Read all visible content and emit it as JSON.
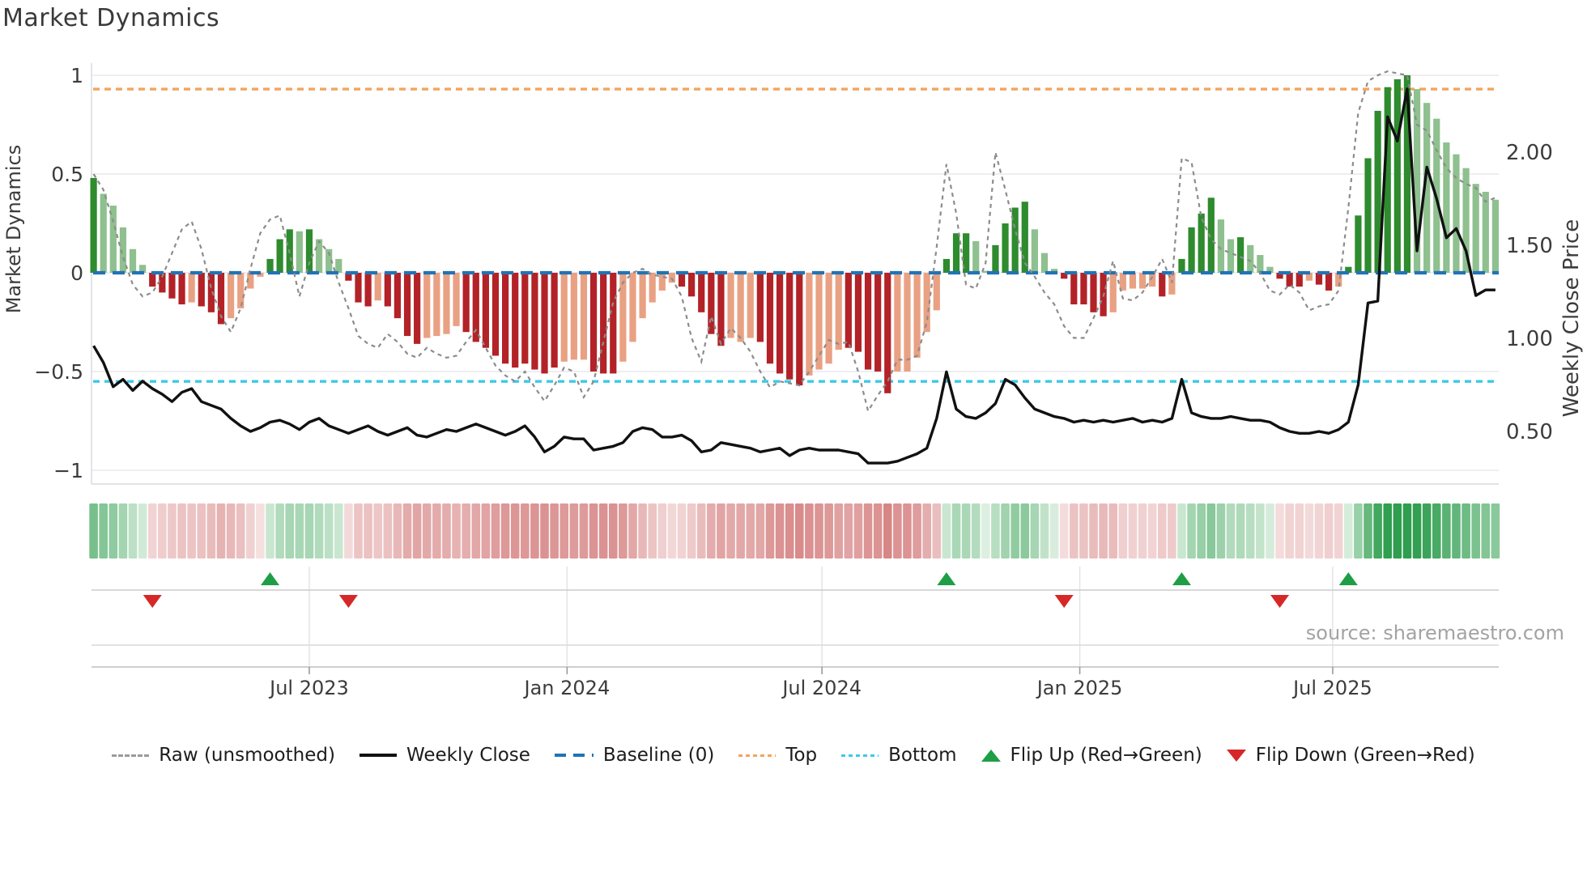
{
  "title": "Market Dynamics",
  "source": "source: sharemaestro.com",
  "axes": {
    "left_label": "Market Dynamics",
    "right_label": "Weekly Close Price",
    "left_ticks": [
      {
        "v": 1,
        "label": "1"
      },
      {
        "v": 0.5,
        "label": "0.5"
      },
      {
        "v": 0,
        "label": "0"
      },
      {
        "v": -0.5,
        "label": "−0.5"
      },
      {
        "v": -1,
        "label": "−1"
      }
    ],
    "right_ticks": [
      {
        "v": 2.0,
        "label": "2.00"
      },
      {
        "v": 1.5,
        "label": "1.50"
      },
      {
        "v": 1.0,
        "label": "1.00"
      },
      {
        "v": 0.5,
        "label": "0.50"
      }
    ],
    "x_ticks": [
      {
        "week": 22,
        "label": "Jul 2023"
      },
      {
        "week": 48.3,
        "label": "Jan 2024"
      },
      {
        "week": 74.3,
        "label": "Jul 2024"
      },
      {
        "week": 100.6,
        "label": "Jan 2025"
      },
      {
        "week": 126.4,
        "label": "Jul 2025"
      }
    ]
  },
  "legend": {
    "items": [
      {
        "label": "Raw (unsmoothed)",
        "swatch": "dashgray"
      },
      {
        "label": "Weekly Close",
        "swatch": "solidblack"
      },
      {
        "label": "Baseline (0)",
        "swatch": "longdashblue"
      },
      {
        "label": "Top",
        "swatch": "dotorange"
      },
      {
        "label": "Bottom",
        "swatch": "dotcyan"
      },
      {
        "label": "Flip Up (Red→Green)",
        "swatch": "triup"
      },
      {
        "label": "Flip Down (Green→Red)",
        "swatch": "tridown"
      }
    ]
  },
  "chart_data": {
    "type": "bar",
    "subtype": "weekly-oscillator-with-price-overlay",
    "x_unit": "week",
    "n_points": 144,
    "ylim_left": [
      -1.07,
      1.06
    ],
    "ylim_right_labels": [
      0.5,
      2.0
    ],
    "grid": "horizontal-left-axis",
    "legend_position": "bottom-center",
    "reference_lines": {
      "baseline": 0,
      "top": 0.93,
      "bottom": -0.55
    },
    "series": [
      {
        "name": "Oscillator (bars)",
        "axis": "left",
        "values": [
          0.48,
          0.4,
          0.34,
          0.23,
          0.12,
          0.04,
          -0.07,
          -0.1,
          -0.13,
          -0.16,
          -0.15,
          -0.17,
          -0.2,
          -0.26,
          -0.23,
          -0.18,
          -0.08,
          -0.02,
          0.07,
          0.17,
          0.22,
          0.21,
          0.22,
          0.17,
          0.12,
          0.07,
          -0.04,
          -0.15,
          -0.17,
          -0.14,
          -0.17,
          -0.23,
          -0.32,
          -0.36,
          -0.33,
          -0.32,
          -0.31,
          -0.27,
          -0.3,
          -0.35,
          -0.38,
          -0.42,
          -0.46,
          -0.48,
          -0.46,
          -0.49,
          -0.51,
          -0.48,
          -0.45,
          -0.44,
          -0.44,
          -0.5,
          -0.51,
          -0.51,
          -0.45,
          -0.35,
          -0.23,
          -0.15,
          -0.09,
          -0.05,
          -0.07,
          -0.12,
          -0.2,
          -0.31,
          -0.37,
          -0.33,
          -0.35,
          -0.33,
          -0.35,
          -0.46,
          -0.51,
          -0.54,
          -0.57,
          -0.52,
          -0.49,
          -0.46,
          -0.39,
          -0.38,
          -0.4,
          -0.49,
          -0.5,
          -0.61,
          -0.5,
          -0.5,
          -0.43,
          -0.3,
          -0.19,
          0.07,
          0.2,
          0.2,
          0.16,
          0.01,
          0.14,
          0.25,
          0.33,
          0.36,
          0.22,
          0.1,
          0.02,
          -0.03,
          -0.16,
          -0.16,
          -0.2,
          -0.22,
          -0.2,
          -0.09,
          -0.08,
          -0.08,
          -0.07,
          -0.12,
          -0.11,
          0.07,
          0.23,
          0.3,
          0.38,
          0.27,
          0.17,
          0.18,
          0.14,
          0.09,
          0.03,
          -0.03,
          -0.07,
          -0.07,
          -0.04,
          -0.06,
          -0.09,
          -0.07,
          0.03,
          0.29,
          0.58,
          0.82,
          0.94,
          0.98,
          1.0,
          0.93,
          0.86,
          0.78,
          0.66,
          0.6,
          0.53,
          0.45,
          0.41,
          0.37
        ],
        "strong_shade": [
          1,
          0,
          0,
          0,
          0,
          0,
          1,
          1,
          1,
          1,
          0,
          1,
          1,
          1,
          0,
          0,
          0,
          0,
          1,
          1,
          1,
          0,
          1,
          0,
          0,
          0,
          1,
          1,
          1,
          0,
          1,
          1,
          1,
          1,
          0,
          0,
          0,
          0,
          1,
          1,
          1,
          1,
          1,
          1,
          1,
          1,
          1,
          1,
          0,
          0,
          0,
          1,
          1,
          1,
          0,
          0,
          0,
          0,
          0,
          0,
          1,
          1,
          1,
          1,
          1,
          0,
          0,
          0,
          1,
          1,
          1,
          1,
          1,
          0,
          0,
          0,
          0,
          1,
          1,
          1,
          1,
          1,
          0,
          0,
          0,
          0,
          0,
          1,
          1,
          1,
          0,
          0,
          1,
          1,
          1,
          1,
          0,
          0,
          0,
          1,
          1,
          1,
          1,
          1,
          0,
          0,
          0,
          0,
          0,
          1,
          0,
          1,
          1,
          1,
          1,
          0,
          0,
          1,
          0,
          0,
          0,
          1,
          1,
          1,
          0,
          1,
          1,
          0,
          1,
          1,
          1,
          1,
          1,
          1,
          1,
          0,
          0,
          0,
          0,
          0,
          0,
          0,
          0,
          0
        ]
      },
      {
        "name": "Raw (unsmoothed)",
        "axis": "left",
        "values": [
          0.5,
          0.42,
          0.26,
          0.08,
          -0.06,
          -0.12,
          -0.1,
          -0.02,
          0.1,
          0.22,
          0.26,
          0.12,
          -0.08,
          -0.22,
          -0.3,
          -0.18,
          0.02,
          0.2,
          0.27,
          0.29,
          0.1,
          -0.12,
          0.05,
          0.16,
          0.1,
          -0.05,
          -0.18,
          -0.32,
          -0.36,
          -0.38,
          -0.31,
          -0.35,
          -0.41,
          -0.43,
          -0.38,
          -0.41,
          -0.43,
          -0.42,
          -0.35,
          -0.29,
          -0.38,
          -0.47,
          -0.52,
          -0.55,
          -0.5,
          -0.58,
          -0.65,
          -0.57,
          -0.48,
          -0.5,
          -0.63,
          -0.55,
          -0.35,
          -0.15,
          -0.05,
          0.0,
          0.02,
          -0.01,
          -0.02,
          -0.03,
          -0.12,
          -0.33,
          -0.45,
          -0.22,
          -0.36,
          -0.28,
          -0.33,
          -0.4,
          -0.5,
          -0.58,
          -0.55,
          -0.56,
          -0.57,
          -0.5,
          -0.42,
          -0.34,
          -0.36,
          -0.35,
          -0.5,
          -0.7,
          -0.62,
          -0.55,
          -0.44,
          -0.44,
          -0.42,
          -0.25,
          0.13,
          0.55,
          0.3,
          -0.06,
          -0.08,
          0.05,
          0.61,
          0.42,
          0.22,
          0.05,
          -0.02,
          -0.1,
          -0.16,
          -0.27,
          -0.33,
          -0.33,
          -0.23,
          -0.12,
          0.06,
          -0.13,
          -0.14,
          -0.1,
          -0.02,
          0.07,
          -0.05,
          0.58,
          0.56,
          0.28,
          0.17,
          0.12,
          0.1,
          0.08,
          0.06,
          0.0,
          -0.09,
          -0.11,
          -0.06,
          -0.1,
          -0.19,
          -0.17,
          -0.16,
          -0.09,
          0.33,
          0.81,
          0.97,
          1.0,
          1.02,
          1.01,
          1.0,
          0.75,
          0.72,
          0.62,
          0.53,
          0.48,
          0.45,
          0.43,
          0.36,
          0.38
        ]
      },
      {
        "name": "Weekly Close",
        "axis": "right",
        "values": [
          0.96,
          0.87,
          0.74,
          0.78,
          0.72,
          0.77,
          0.73,
          0.7,
          0.66,
          0.71,
          0.73,
          0.66,
          0.64,
          0.62,
          0.57,
          0.53,
          0.5,
          0.52,
          0.55,
          0.56,
          0.54,
          0.51,
          0.55,
          0.57,
          0.53,
          0.51,
          0.49,
          0.51,
          0.53,
          0.5,
          0.48,
          0.5,
          0.52,
          0.48,
          0.47,
          0.49,
          0.51,
          0.5,
          0.52,
          0.54,
          0.52,
          0.5,
          0.48,
          0.5,
          0.53,
          0.47,
          0.39,
          0.42,
          0.47,
          0.46,
          0.46,
          0.4,
          0.41,
          0.42,
          0.44,
          0.5,
          0.52,
          0.51,
          0.47,
          0.47,
          0.48,
          0.45,
          0.39,
          0.4,
          0.44,
          0.43,
          0.42,
          0.41,
          0.39,
          0.4,
          0.41,
          0.37,
          0.4,
          0.41,
          0.4,
          0.4,
          0.4,
          0.39,
          0.38,
          0.33,
          0.33,
          0.33,
          0.34,
          0.36,
          0.38,
          0.41,
          0.57,
          0.82,
          0.62,
          0.58,
          0.57,
          0.6,
          0.65,
          0.78,
          0.75,
          0.68,
          0.62,
          0.6,
          0.58,
          0.57,
          0.55,
          0.56,
          0.55,
          0.56,
          0.55,
          0.56,
          0.57,
          0.55,
          0.56,
          0.55,
          0.57,
          0.78,
          0.6,
          0.58,
          0.57,
          0.57,
          0.58,
          0.57,
          0.56,
          0.56,
          0.55,
          0.52,
          0.5,
          0.49,
          0.49,
          0.5,
          0.49,
          0.51,
          0.55,
          0.75,
          1.19,
          1.2,
          2.19,
          2.06,
          2.34,
          1.47,
          1.92,
          1.75,
          1.54,
          1.59,
          1.47,
          1.23,
          1.26,
          1.26
        ]
      }
    ],
    "flip_markers": [
      {
        "week": 6,
        "dir": "down"
      },
      {
        "week": 18,
        "dir": "up"
      },
      {
        "week": 26,
        "dir": "down"
      },
      {
        "week": 87,
        "dir": "up"
      },
      {
        "week": 99,
        "dir": "down"
      },
      {
        "week": 111,
        "dir": "up"
      },
      {
        "week": 121,
        "dir": "down"
      },
      {
        "week": 128,
        "dir": "up"
      }
    ],
    "heatmap_strip": "mirrors oscillator bar sign and magnitude (red to green)"
  },
  "colors": {
    "bar_green_strong": "#2e8b2e",
    "bar_green_soft": "#8fc08f",
    "bar_red_strong": "#b22227",
    "bar_red_soft": "#e9a183",
    "baseline": "#2273b4",
    "top_line": "#f2a45f",
    "bottom_line": "#3cc9e8",
    "raw_line": "#8c8c8c",
    "price_line": "#111111",
    "grid": "#e9e9ef",
    "flip_up": "#1e9e45",
    "flip_down": "#d62828",
    "heat_green_max": "#2f9e4f",
    "heat_red_max": "#cb6060",
    "tick_text": "#3c3c3c",
    "source_text": "#a3a3a3"
  }
}
